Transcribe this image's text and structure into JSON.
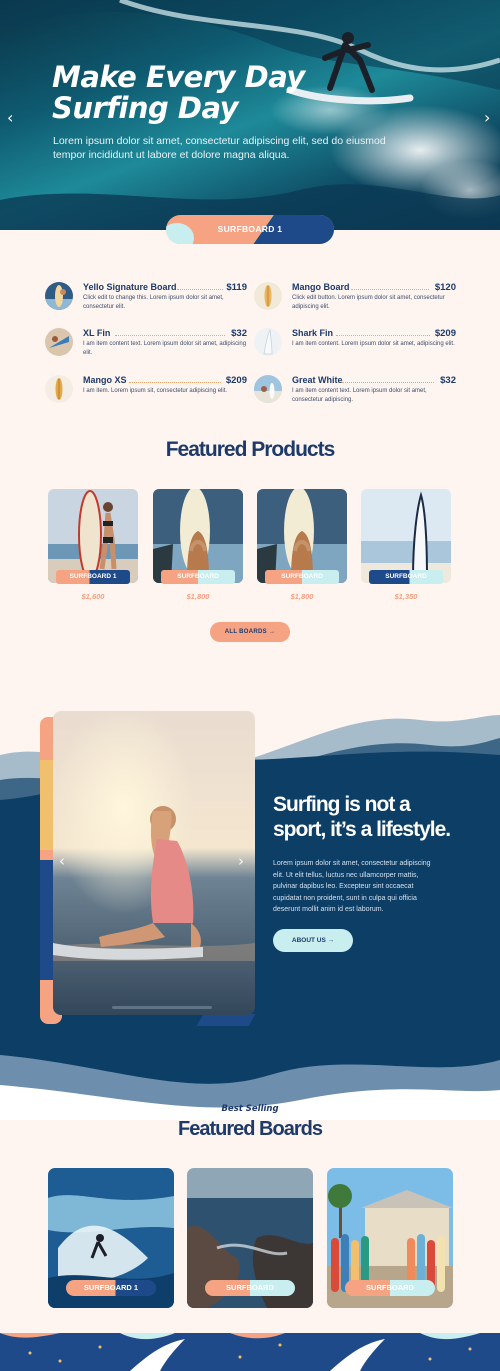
{
  "hero": {
    "title_line1": "Make Every Day",
    "title_line2": "Surfing Day",
    "text": "Lorem ipsum dolor sit amet, consectetur adipiscing elit, sed do eiusmod tempor incididunt ut labore et dolore magna aliqua.",
    "prev_icon": "chevron-left-icon",
    "next_icon": "chevron-right-icon"
  },
  "category_pill": {
    "label": "SURFBOARD 1"
  },
  "menu": [
    {
      "name": "Yello Signature Board",
      "price": "$119",
      "desc": "Click edit to change this. Lorem ipsum dolor sit amet, consectetur elit."
    },
    {
      "name": "Mango Board",
      "price": "$120",
      "desc": "Click edit button. Lorem ipsum dolor sit amet, consectetur adipiscing elit."
    },
    {
      "name": "XL Fin",
      "price": "$32",
      "desc": "I am item content text. Lorem ipsum dolor sit amet, adipiscing elit."
    },
    {
      "name": "Shark Fin",
      "price": "$209",
      "desc": "I am item content. Lorem ipsum dolor sit amet, adipiscing elit."
    },
    {
      "name": "Mango XS",
      "price": "$209",
      "desc": "I am item. Lorem ipsum sit, consectetur adipiscing elit."
    },
    {
      "name": "Great White",
      "price": "$32",
      "desc": "I am item content text. Lorem ipsum dolor sit amet, consectetur adipiscing."
    }
  ],
  "featured_products": {
    "title": "Featured Products",
    "items": [
      {
        "tag": "SURFBOARD 1",
        "price": "$1,600"
      },
      {
        "tag": "SURFBOARD",
        "price": "$1,800"
      },
      {
        "tag": "SURFBOARD",
        "price": "$1,800"
      },
      {
        "tag": "SURFBOARD",
        "price": "$1,350"
      }
    ],
    "button_label": "ALL BOARDS →"
  },
  "about": {
    "heading": "Surfing is not a sport, it’s a lifestyle.",
    "text": "Lorem ipsum dolor sit amet, consectetur adipiscing elit. Ut elit tellus, luctus nec ullamcorper mattis, pulvinar dapibus leo. Excepteur sint occaecat cupidatat non proident, sunt in culpa qui officia deserunt mollit anim id est laborum.",
    "button_label": "ABOUT US →"
  },
  "best_selling": {
    "subtitle": "Best Selling",
    "title": "Featured Boards",
    "items": [
      {
        "tag": "SURFBOARD 1"
      },
      {
        "tag": "SURFBOARD"
      },
      {
        "tag": "SURFBOARD"
      }
    ]
  },
  "colors": {
    "navy": "#1d3a6b",
    "coral": "#f6a384",
    "teal": "#c9eef0",
    "deep_blue": "#0c3e66",
    "cream": "#fef5f1"
  }
}
